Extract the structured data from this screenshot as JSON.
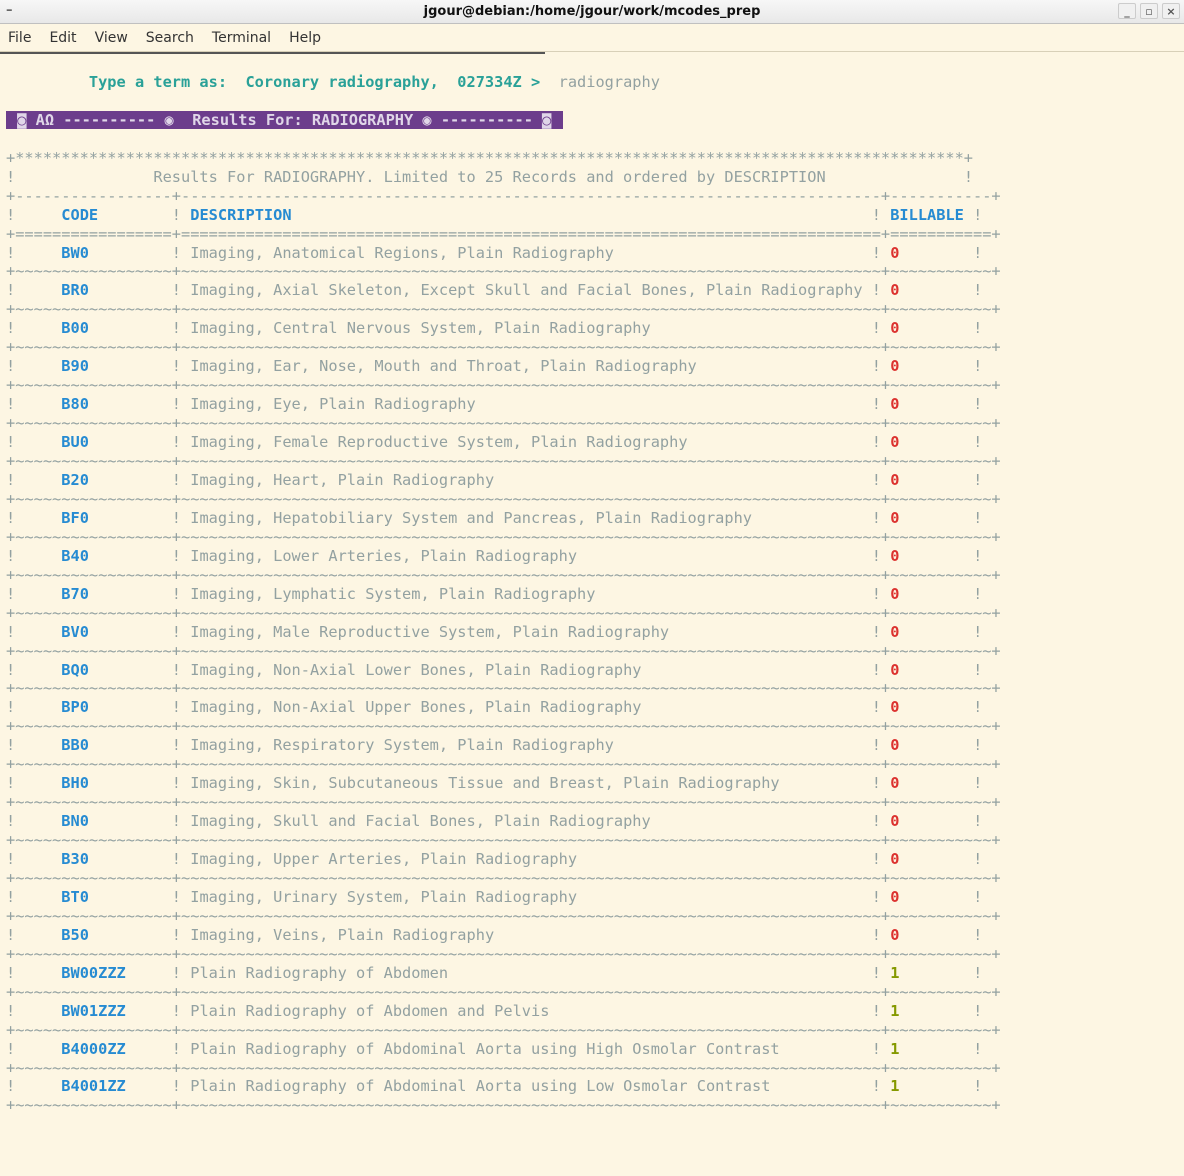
{
  "window": {
    "title": "jgour@debian:/home/jgour/work/mcodes_prep"
  },
  "menubar": [
    "File",
    "Edit",
    "View",
    "Search",
    "Terminal",
    "Help"
  ],
  "prompt": {
    "hint_prefix": "Type a term as:",
    "hint_examples": "Coronary radiography,  027334Z >",
    "input_value": "radiography"
  },
  "banner": {
    "left_marker": "◙ AΩ ----------",
    "circ1": "◉",
    "text": "  Results For: RADIOGRAPHY ",
    "circ2": "◉",
    "dashes_right": " ---------- ",
    "right_marker": "◙"
  },
  "subtitle": "Results For RADIOGRAPHY. Limited to 25 Records and ordered by DESCRIPTION",
  "columns": {
    "c1": "CODE",
    "c2": "DESCRIPTION",
    "c3": "BILLABLE"
  },
  "rows": [
    {
      "code": "BW0",
      "desc": "Imaging, Anatomical Regions, Plain Radiography",
      "bill": "0",
      "bc": "red"
    },
    {
      "code": "BR0",
      "desc": "Imaging, Axial Skeleton, Except Skull and Facial Bones, Plain Radiography",
      "bill": "0",
      "bc": "red"
    },
    {
      "code": "B00",
      "desc": "Imaging, Central Nervous System, Plain Radiography",
      "bill": "0",
      "bc": "red"
    },
    {
      "code": "B90",
      "desc": "Imaging, Ear, Nose, Mouth and Throat, Plain Radiography",
      "bill": "0",
      "bc": "red"
    },
    {
      "code": "B80",
      "desc": "Imaging, Eye, Plain Radiography",
      "bill": "0",
      "bc": "red"
    },
    {
      "code": "BU0",
      "desc": "Imaging, Female Reproductive System, Plain Radiography",
      "bill": "0",
      "bc": "red"
    },
    {
      "code": "B20",
      "desc": "Imaging, Heart, Plain Radiography",
      "bill": "0",
      "bc": "red"
    },
    {
      "code": "BF0",
      "desc": "Imaging, Hepatobiliary System and Pancreas, Plain Radiography",
      "bill": "0",
      "bc": "red"
    },
    {
      "code": "B40",
      "desc": "Imaging, Lower Arteries, Plain Radiography",
      "bill": "0",
      "bc": "red"
    },
    {
      "code": "B70",
      "desc": "Imaging, Lymphatic System, Plain Radiography",
      "bill": "0",
      "bc": "red"
    },
    {
      "code": "BV0",
      "desc": "Imaging, Male Reproductive System, Plain Radiography",
      "bill": "0",
      "bc": "red"
    },
    {
      "code": "BQ0",
      "desc": "Imaging, Non-Axial Lower Bones, Plain Radiography",
      "bill": "0",
      "bc": "red"
    },
    {
      "code": "BP0",
      "desc": "Imaging, Non-Axial Upper Bones, Plain Radiography",
      "bill": "0",
      "bc": "red"
    },
    {
      "code": "BB0",
      "desc": "Imaging, Respiratory System, Plain Radiography",
      "bill": "0",
      "bc": "red"
    },
    {
      "code": "BH0",
      "desc": "Imaging, Skin, Subcutaneous Tissue and Breast, Plain Radiography",
      "bill": "0",
      "bc": "red"
    },
    {
      "code": "BN0",
      "desc": "Imaging, Skull and Facial Bones, Plain Radiography",
      "bill": "0",
      "bc": "red"
    },
    {
      "code": "B30",
      "desc": "Imaging, Upper Arteries, Plain Radiography",
      "bill": "0",
      "bc": "red"
    },
    {
      "code": "BT0",
      "desc": "Imaging, Urinary System, Plain Radiography",
      "bill": "0",
      "bc": "red"
    },
    {
      "code": "B50",
      "desc": "Imaging, Veins, Plain Radiography",
      "bill": "0",
      "bc": "red"
    },
    {
      "code": "BW00ZZZ",
      "desc": "Plain Radiography of Abdomen",
      "bill": "1",
      "bc": "green"
    },
    {
      "code": "BW01ZZZ",
      "desc": "Plain Radiography of Abdomen and Pelvis",
      "bill": "1",
      "bc": "green"
    },
    {
      "code": "B4000ZZ",
      "desc": "Plain Radiography of Abdominal Aorta using High Osmolar Contrast",
      "bill": "1",
      "bc": "green"
    },
    {
      "code": "B4001ZZ",
      "desc": "Plain Radiography of Abdominal Aorta using Low Osmolar Contrast",
      "bill": "1",
      "bc": "green"
    }
  ]
}
